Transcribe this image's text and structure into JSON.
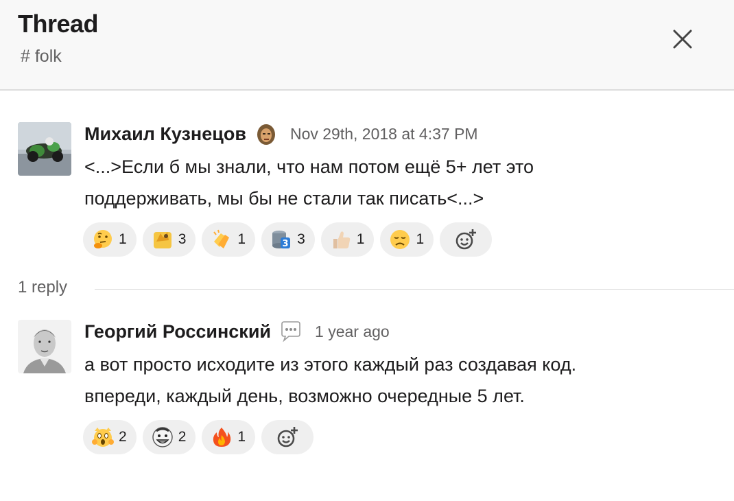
{
  "header": {
    "title": "Thread",
    "channel": "# folk"
  },
  "messages": [
    {
      "author": "Михаил Кузнецов",
      "status_icon": "warrior-face-icon",
      "timestamp": "Nov 29th, 2018 at 4:37 PM",
      "lines": [
        "<...>Если б мы знали, что нам потом ещё 5+ лет это",
        "поддерживать, мы бы не стали так писать<...>"
      ],
      "reactions": [
        {
          "icon": "thinking-face-icon",
          "count": "1"
        },
        {
          "icon": "facepalm-icon",
          "count": "3"
        },
        {
          "icon": "clapping-hands-icon",
          "count": "1"
        },
        {
          "icon": "database-3-icon",
          "count": "3"
        },
        {
          "icon": "thumbs-up-icon",
          "count": "1"
        },
        {
          "icon": "disappointed-face-icon",
          "count": "1"
        }
      ]
    },
    {
      "author": "Георгий Россинский",
      "status_icon": "speech-bubble-icon",
      "timestamp": "1 year ago",
      "lines": [
        "а вот просто исходите из этого каждый раз создавая код.",
        "впереди, каждый день, возможно очередные 5 лет."
      ],
      "reactions": [
        {
          "icon": "screaming-cat-icon",
          "count": "2"
        },
        {
          "icon": "troll-face-icon",
          "count": "2"
        },
        {
          "icon": "fire-icon",
          "count": "1"
        }
      ]
    }
  ],
  "replies_divider": "1 reply",
  "colors": {
    "header_bg": "#f8f8f8",
    "text": "#1d1c1d",
    "muted": "#616061",
    "pill_bg": "#efefef"
  }
}
